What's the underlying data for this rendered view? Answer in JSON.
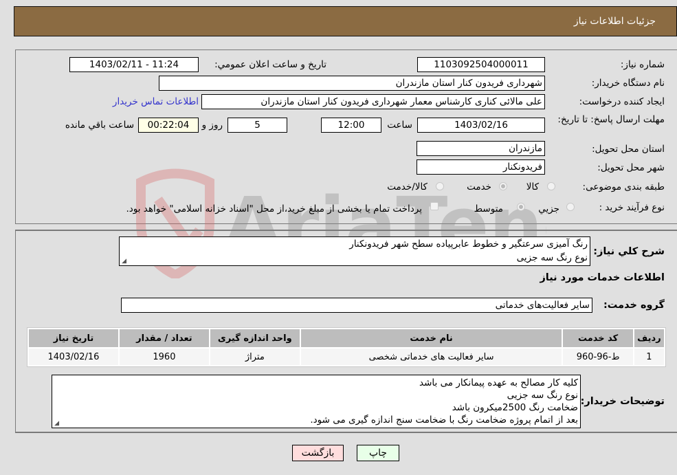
{
  "header": {
    "title": "جزئیات اطلاعات نیاز"
  },
  "form": {
    "need_number": {
      "label": "شماره نیاز:",
      "value": "1103092504000011"
    },
    "announce_datetime": {
      "label": "تاریخ و ساعت اعلان عمومي:",
      "value": "1403/02/11 - 11:24"
    },
    "buyer_org": {
      "label": "نام دستگاه خریدار:",
      "value": "شهرداری فریدون کنار استان مازندران"
    },
    "requester": {
      "label": "ایجاد کننده درخواست:",
      "value": "علی مالائی کناری کارشناس معمار شهرداری فریدون کنار استان مازندران"
    },
    "buyer_contact_link": "اطلاعات تماس خریدار",
    "deadline": {
      "label": "مهلت ارسال پاسخ: تا تاریخ:",
      "date": "1403/02/16",
      "time_label": "ساعت",
      "time": "12:00",
      "days": "5",
      "days_label": "روز و",
      "remaining": "00:22:04",
      "remaining_label": "ساعت باقي مانده"
    },
    "delivery_province": {
      "label": "استان محل تحویل:",
      "value": "مازندران"
    },
    "delivery_city": {
      "label": "شهر محل تحویل:",
      "value": "فریدونکنار"
    },
    "category": {
      "label": "طبقه بندی موضوعی:",
      "options": [
        "کالا",
        "خدمت",
        "کالا/خدمت"
      ],
      "selected": "خدمت"
    },
    "purchase_type": {
      "label": "نوع فرآیند خرید :",
      "options": [
        "جزيي",
        "متوسط"
      ],
      "selected": "متوسط",
      "treasury_note": "پرداخت تمام یا بخشی از مبلغ خرید،از محل \"اسناد خزانه اسلامی\" خواهد بود."
    }
  },
  "description": {
    "label": "شرح کلي نياز:",
    "lines": [
      "رنگ آمیزی سرعتگیر و خطوط عابرپیاده سطح شهر فریدونکنار",
      "نوع رنگ سه جزیی"
    ]
  },
  "services_section": {
    "title": "اطلاعات خدمات مورد نیاز",
    "group_label": "گروه خدمت:",
    "group_value": "سایر فعالیت‌های خدماتی"
  },
  "services_table": {
    "columns": [
      "ردیف",
      "کد خدمت",
      "نام خدمت",
      "واحد اندازه گیری",
      "تعداد / مقدار",
      "تاریخ نیاز"
    ],
    "rows": [
      [
        "1",
        "ط-96-960",
        "سایر فعالیت های خدماتی شخصی",
        "متراژ",
        "1960",
        "1403/02/16"
      ]
    ]
  },
  "buyer_notes": {
    "label": "توضیحات خریدار:",
    "lines": [
      "کلیه کار مصالح به عهده پیمانکار می باشد",
      "نوع رنگ سه جزیی",
      "ضخامت رنگ 2500میکرون باشد",
      "بعد از اتمام پروژه ضخامت رنگ با ضخامت سنج اندازه گیری می شود."
    ]
  },
  "buttons": {
    "print": "چاپ",
    "back": "بازگشت"
  },
  "watermark": {
    "text": "AriaTender.neT"
  },
  "colors": {
    "header_bg": "#8b6b42",
    "link": "#3333cc",
    "print_bg": "#e8ffe8",
    "back_bg": "#ffdddd",
    "remaining_bg": "#ffffe6"
  }
}
